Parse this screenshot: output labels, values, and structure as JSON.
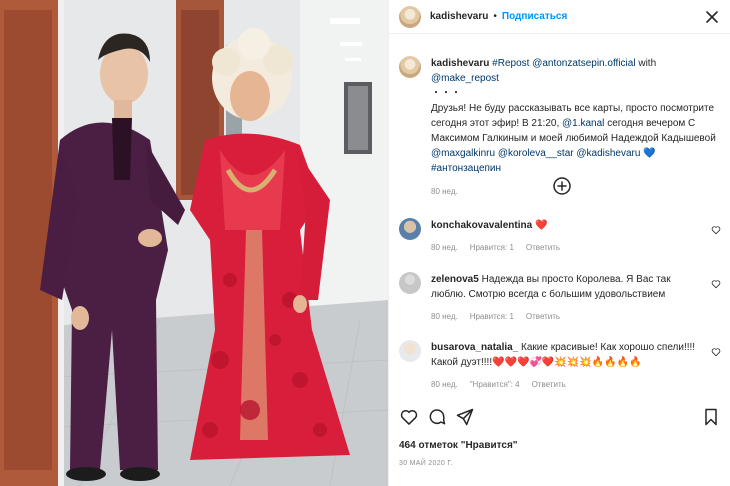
{
  "header": {
    "username": "kadishevaru",
    "separator": "•",
    "follow_label": "Подписаться",
    "close_icon": "close-icon"
  },
  "caption": {
    "username": "kadishevaru",
    "repost_tag": "#Repost",
    "mention_source": "@antonzatsepin.official",
    "with_text": "with",
    "mention_app": "@make_repost",
    "ellipsis": "・・・",
    "text_1": "Друзья! Не буду рассказывать все карты, просто посмотрите сегодня этот эфир! В 21:20,",
    "mention_channel": "@1.kanal",
    "text_2": "сегодня вечером С Максимом Галкиным и моей любимой Надеждой Кадышевой",
    "mention_1": "@maxgalkinru",
    "mention_2": "@koroleva__star",
    "mention_3": "@kadishevaru",
    "emoji_heart": "💙",
    "hashtag": "#антонзацепин",
    "time": "80 нед."
  },
  "load_more_icon": "plus-circle-icon",
  "comments": [
    {
      "username": "konchakovavalentina",
      "text": "❤️",
      "time": "80 нед.",
      "likes": "Нравится: 1",
      "reply": "Ответить"
    },
    {
      "username": "zelenova5",
      "text": "Надежда вы просто Королева. Я Вас так люблю. Смотрю всегда с большим удовольствием",
      "time": "80 нед.",
      "likes": "Нравится: 1",
      "reply": "Ответить"
    },
    {
      "username": "busarova_natalia_",
      "text": "Какие красивые! Как хорошо спели!!!! Какой дуэт!!!!❤️❤️❤️💞❤️💥💥💥🔥🔥🔥🔥",
      "time": "80 нед.",
      "likes": "\"Нравится\": 4",
      "reply": "Ответить"
    }
  ],
  "actions": {
    "like_icon": "heart-icon",
    "comment_icon": "comment-icon",
    "share_icon": "send-icon",
    "save_icon": "bookmark-icon"
  },
  "likes_count": "464 отметок \"Нравится\"",
  "date": "30 МАЙ 2020 Г.",
  "colors": {
    "link": "#00376b",
    "follow": "#0095f6",
    "muted": "#8e8e8e",
    "heart": "#ed4956"
  }
}
